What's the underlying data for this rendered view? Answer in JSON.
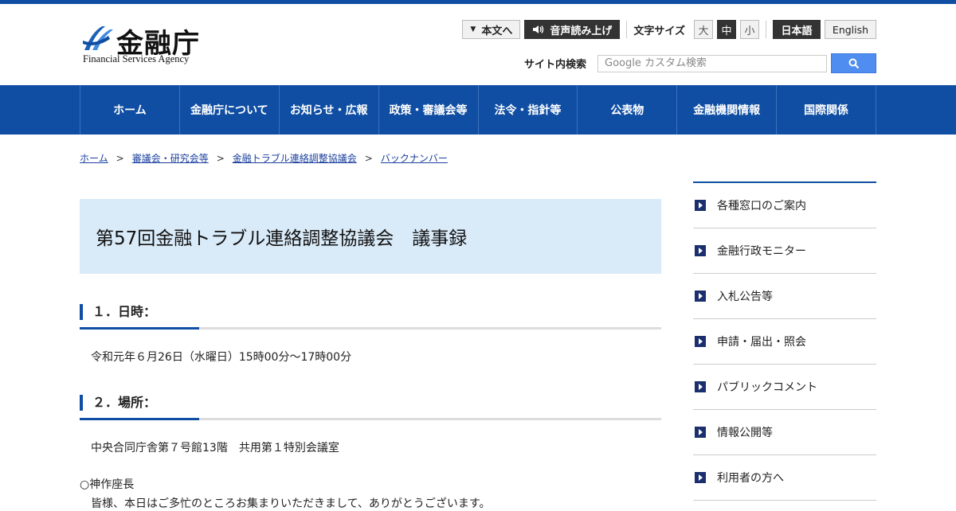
{
  "logo": {
    "name_ja": "金融庁",
    "name_en": "Financial Services Agency"
  },
  "util": {
    "skip_label": "本文へ",
    "read_aloud_label": "音声読み上げ",
    "font_size_label": "文字サイズ",
    "font_sizes": [
      "大",
      "中",
      "小"
    ],
    "lang_ja": "日本語",
    "lang_en": "English"
  },
  "search": {
    "label": "サイト内検索",
    "placeholder": "Google カスタム検索"
  },
  "nav": [
    "ホーム",
    "金融庁について",
    "お知らせ・広報",
    "政策・審議会等",
    "法令・指針等",
    "公表物",
    "金融機関情報",
    "国際関係"
  ],
  "breadcrumb": [
    "ホーム",
    "審議会・研究会等",
    "金融トラブル連絡調整協議会",
    "バックナンバー"
  ],
  "page_title": "第57回金融トラブル連絡調整協議会　議事録",
  "sections": [
    {
      "heading": "１．日時：",
      "body": "令和元年６月26日（水曜日）15時00分～17時00分"
    },
    {
      "heading": "２．場所：",
      "body": "中央合同庁舎第７号館13階　共用第１特別会議室"
    }
  ],
  "speaker": "○神作座長",
  "speech": "皆様、本日はご多忙のところお集まりいただきまして、ありがとうございます。",
  "sidebar": [
    "各種窓口のご案内",
    "金融行政モニター",
    "入札公告等",
    "申請・届出・照会",
    "パブリックコメント",
    "情報公開等",
    "利用者の方へ"
  ],
  "colors": {
    "brand": "#0f4ea3",
    "title_bg": "#d9eaf8"
  }
}
